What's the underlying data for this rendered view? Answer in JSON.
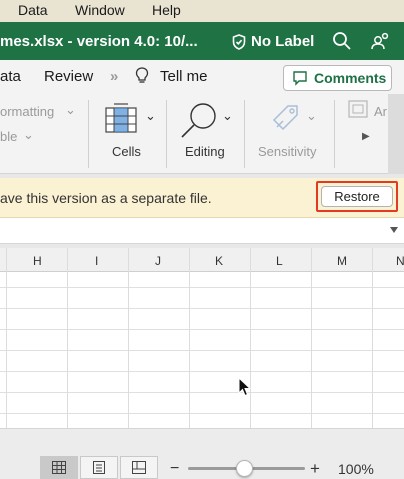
{
  "menubar": {
    "items": [
      "Data",
      "Window",
      "Help"
    ]
  },
  "titlebar": {
    "title": "mes.xlsx  -  version 4.0: 10/...",
    "label": "No Label",
    "shield_icon": "shield-icon",
    "search_icon": "search-icon",
    "share_icon": "share-people-icon"
  },
  "tabs": {
    "items": [
      "ata",
      "Review",
      "Tell me"
    ],
    "more": "»",
    "comments": "Comments"
  },
  "ribbon": {
    "formatting": "ormatting",
    "table": "ble",
    "cells": "Cells",
    "editing": "Editing",
    "sensitivity": "Sensitivity",
    "ar_label": "Ar"
  },
  "infobar": {
    "message": "ave this version as a separate file.",
    "restore": "Restore"
  },
  "grid": {
    "columns": [
      "H",
      "I",
      "J",
      "K",
      "L",
      "M",
      "N"
    ]
  },
  "statusbar": {
    "minus": "−",
    "plus": "+",
    "zoom": "100%",
    "zoom_level_percent": 100
  },
  "colors": {
    "excel_green": "#1f7244",
    "highlight_red": "#e53a22",
    "infobar_bg": "#fbf1d3"
  }
}
